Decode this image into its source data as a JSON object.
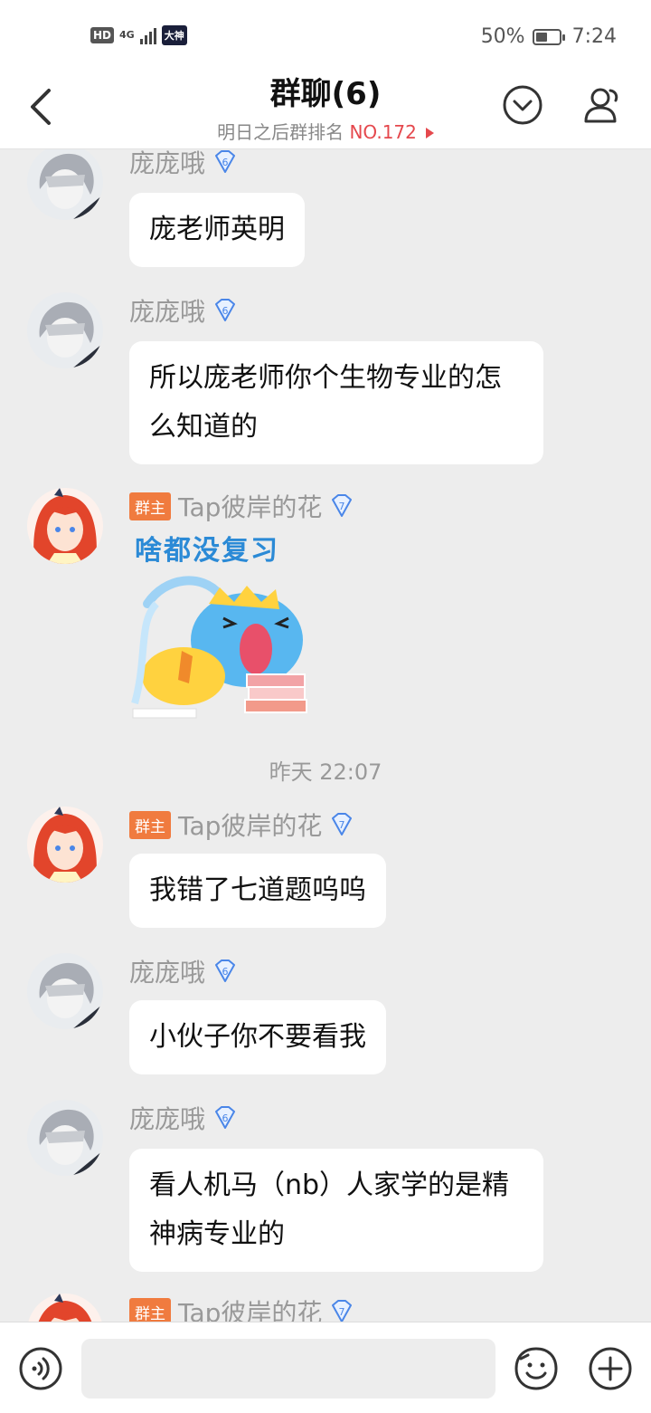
{
  "status": {
    "signal_label": "4G",
    "battery_pct": "50%",
    "battery_level": 0.5,
    "time": "7:24",
    "hd": "HD",
    "app_badge": "大神"
  },
  "header": {
    "title": "群聊(6)",
    "subtitle_prefix": "明日之后群排名 ",
    "rank": "NO.172"
  },
  "owner_badge": "群主",
  "messages": [
    {
      "sender": "庞庞哦",
      "level": "6",
      "text": "庞老师英明"
    },
    {
      "sender": "庞庞哦",
      "level": "6",
      "text": "所以庞老师你个生物专业的怎么知道的"
    },
    {
      "sender": "Tap彼岸的花",
      "level": "7",
      "sticker_text": "啥都没复习"
    },
    {
      "sender": "Tap彼岸的花",
      "level": "7",
      "text": "我错了七道题呜呜"
    },
    {
      "sender": "庞庞哦",
      "level": "6",
      "text": "小伙子你不要看我"
    },
    {
      "sender": "庞庞哦",
      "level": "6",
      "text": "看人机马（nb）人家学的是精神病专业的"
    },
    {
      "sender": "Tap彼岸的花",
      "level": "7"
    }
  ],
  "timestamp": "昨天 22:07",
  "colors": {
    "accent_red": "#e5484d",
    "owner_orange": "#f07b3f",
    "level_blue": "#4a86e8",
    "background": "#ededed"
  }
}
